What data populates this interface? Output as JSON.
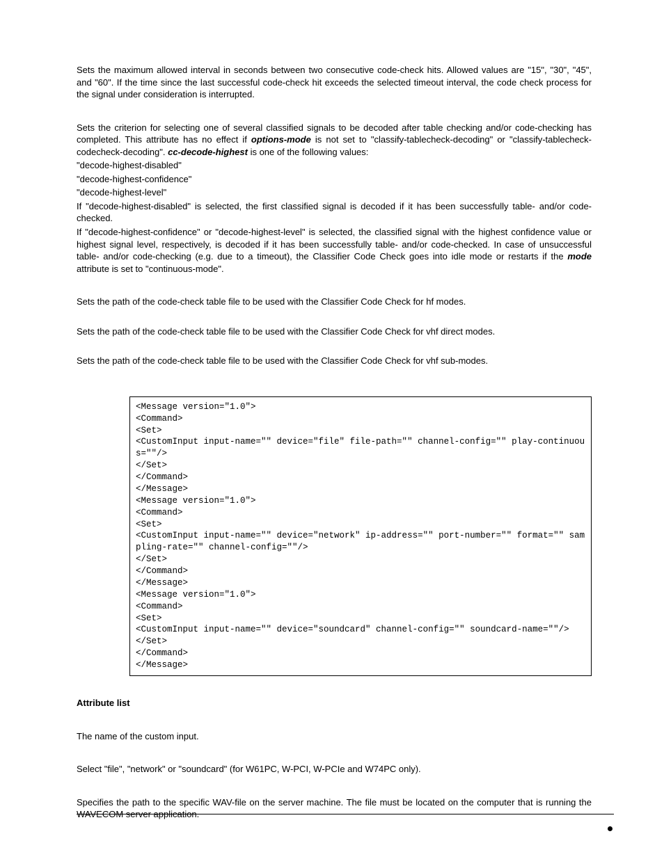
{
  "p1": "Sets the maximum allowed interval in seconds between two consecutive code-check hits. Allowed values are \"15\", \"30\", \"45\", and \"60\". If the time since the last successful code-check hit exceeds the selected timeout interval, the code check process for the signal under consideration is interrupted.",
  "p2_a": "Sets the criterion for selecting one of several classified signals to be decoded after table checking and/or code-checking has completed. This attribute has no effect if ",
  "p2_b": "options-mode",
  "p2_c": " is not set to \"classify-tablecheck-decoding\" or \"classify-tablecheck-codecheck-decoding\". ",
  "p2_d": "cc-decode-highest",
  "p2_e": " is one of the following values:",
  "v1": "\"decode-highest-disabled\"",
  "v2": "\"decode-highest-confidence\"",
  "v3": "\"decode-highest-level\"",
  "p3": "If \"decode-highest-disabled\" is selected, the first classified signal is decoded if it has been successfully table- and/or code-checked.",
  "p4_a": "If \"decode-highest-confidence\" or \"decode-highest-level\" is selected, the classified signal with the highest confidence value or highest signal level, respectively, is decoded if it has been successfully table- and/or code-checked. In case of unsuccessful table- and/or code-checking (e.g. due to a timeout), the Classifier Code Check goes into idle mode or restarts if the ",
  "p4_b": "mode",
  "p4_c": " attribute is set to \"continuous-mode\".",
  "p5": "Sets the path of the code-check table file to be used with the Classifier Code Check for hf modes.",
  "p6": "Sets the path of the code-check table file to be used with the Classifier Code Check for vhf direct modes.",
  "p7": "Sets the path of the code-check table file to be used with the Classifier Code Check for vhf sub-modes.",
  "code": "<Message version=\"1.0\">\n<Command>\n<Set>\n<CustomInput input-name=\"\" device=\"file\" file-path=\"\" channel-config=\"\" play-continuous=\"\"/>\n</Set>\n</Command>\n</Message>\n<Message version=\"1.0\">\n<Command>\n<Set>\n<CustomInput input-name=\"\" device=\"network\" ip-address=\"\" port-number=\"\" format=\"\" sampling-rate=\"\" channel-config=\"\"/>\n</Set>\n</Command>\n</Message>\n<Message version=\"1.0\">\n<Command>\n<Set>\n<CustomInput input-name=\"\" device=\"soundcard\" channel-config=\"\" soundcard-name=\"\"/>\n</Set>\n</Command>\n</Message>",
  "h1": "Attribute list",
  "p8": "The name of the custom input.",
  "p9": "Select \"file\", \"network\" or \"soundcard\" (for W61PC, W-PCI, W-PCIe and W74PC only).",
  "p10": "Specifies the path to the specific WAV-file on the server machine. The file must be located on the computer that is running the WAVECOM server application."
}
